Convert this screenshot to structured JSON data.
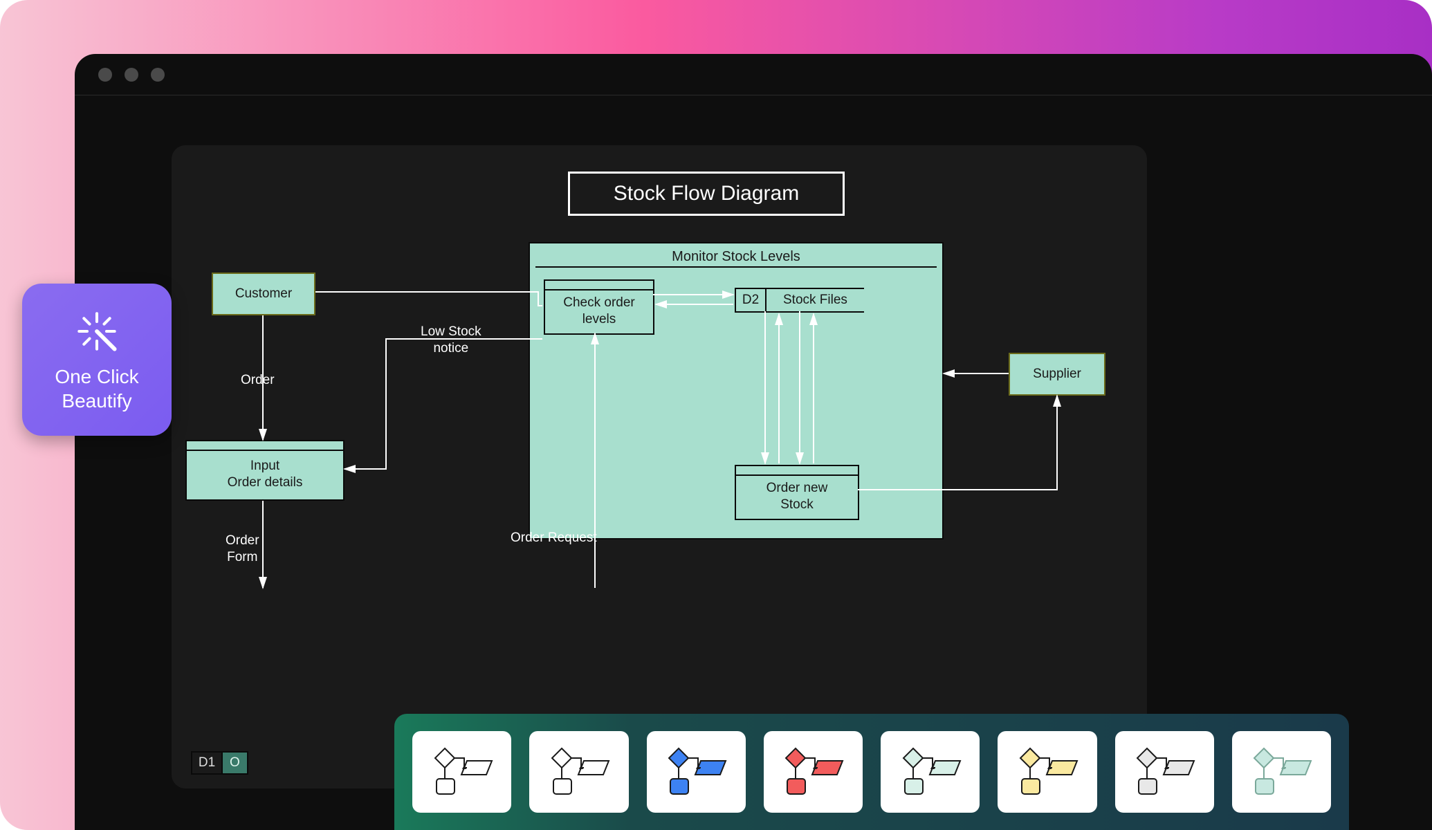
{
  "promo": {
    "title_line1": "One Click",
    "title_line2": "Beautify"
  },
  "diagram": {
    "title": "Stock Flow Diagram",
    "container": {
      "label": "Monitor Stock Levels"
    },
    "nodes": {
      "customer": "Customer",
      "supplier": "Supplier",
      "input_order_line1": "Input",
      "input_order_line2": "Order details",
      "check_order_line1": "Check order",
      "check_order_line2": "levels",
      "order_new_line1": "Order new",
      "order_new_line2": "Stock"
    },
    "datastores": {
      "d1": {
        "id": "D1",
        "label": "O"
      },
      "d2": {
        "id": "D2",
        "label": "Stock Files"
      }
    },
    "edges": {
      "order": "Order",
      "low_stock_line1": "Low Stock",
      "low_stock_line2": "notice",
      "order_form_line1": "Order",
      "order_form_line2": "Form",
      "order_request": "Order Request"
    }
  },
  "palette": {
    "styles": [
      {
        "name": "outline-black",
        "diamond": "#ffffff",
        "square": "#ffffff",
        "par": "#ffffff",
        "stroke": "#1a1a1a"
      },
      {
        "name": "outline-black-2",
        "diamond": "#ffffff",
        "square": "#ffffff",
        "par": "#ffffff",
        "stroke": "#1a1a1a"
      },
      {
        "name": "blue",
        "diamond": "#3d82f2",
        "square": "#3d82f2",
        "par": "#3d82f2",
        "stroke": "#1a1a1a"
      },
      {
        "name": "red",
        "diamond": "#f25c5c",
        "square": "#f25c5c",
        "par": "#f25c5c",
        "stroke": "#1a1a1a"
      },
      {
        "name": "mint",
        "diamond": "#d8f0e8",
        "square": "#d8f0e8",
        "par": "#d8f0e8",
        "stroke": "#1a1a1a"
      },
      {
        "name": "yellow",
        "diamond": "#fae9a0",
        "square": "#fae9a0",
        "par": "#fae9a0",
        "stroke": "#1a1a1a"
      },
      {
        "name": "gray",
        "diamond": "#e8e8e8",
        "square": "#e8e8e8",
        "par": "#e8e8e8",
        "stroke": "#1a1a1a"
      },
      {
        "name": "teal-light",
        "diamond": "#c8e8e0",
        "square": "#c8e8e0",
        "par": "#c8e8e0",
        "stroke": "#7aa89a"
      }
    ]
  }
}
